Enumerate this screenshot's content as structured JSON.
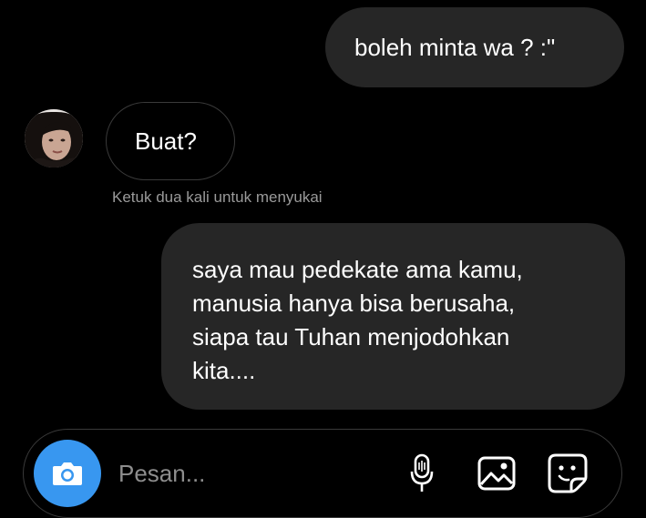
{
  "conversation": {
    "messages": [
      {
        "from": "me",
        "lines": [
          "boleh minta wa ? :\""
        ]
      },
      {
        "from": "contact",
        "lines": [
          "Buat?"
        ]
      },
      {
        "from": "me",
        "lines": [
          "saya mau pedekate ama kamu,",
          "manusia hanya bisa berusaha,",
          "siapa tau Tuhan menjodohkan",
          "kita...."
        ]
      }
    ],
    "like_hint": "Ketuk dua kali untuk menyukai"
  },
  "composer": {
    "placeholder": "Pesan...",
    "camera_icon": "camera-icon",
    "mic_icon": "microphone-icon",
    "gallery_icon": "gallery-icon",
    "sticker_icon": "sticker-icon"
  },
  "colors": {
    "background": "#000000",
    "sent_bubble": "#262626",
    "received_bubble_border": "#3a3a3a",
    "hint_text": "#9a9a9a",
    "camera_button": "#3897f0",
    "placeholder_text": "#8e8e8e"
  }
}
